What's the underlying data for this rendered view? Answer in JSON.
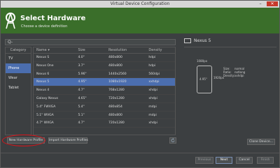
{
  "window": {
    "title": "Virtual Device Configuration"
  },
  "header": {
    "title": "Select Hardware",
    "subtitle": "Choose a device definition"
  },
  "search": {
    "placeholder": "Q-"
  },
  "categories": {
    "header": "Category",
    "items": [
      {
        "label": "TV",
        "selected": false
      },
      {
        "label": "Phone",
        "selected": true
      },
      {
        "label": "Wear",
        "selected": false
      },
      {
        "label": "Tablet",
        "selected": false
      }
    ]
  },
  "table": {
    "columns": [
      "Name ▾",
      "Size",
      "Resolution",
      "Density"
    ],
    "rows": [
      [
        "Nexus S",
        "4.0\"",
        "480x800",
        "hdpi"
      ],
      [
        "Nexus One",
        "3.7\"",
        "480x800",
        "hdpi"
      ],
      [
        "Nexus 6",
        "5.96\"",
        "1440x2560",
        "560dpi"
      ],
      [
        "Nexus 5",
        "4.95\"",
        "1080x1920",
        "xxhdpi"
      ],
      [
        "Nexus 4",
        "4.7\"",
        "768x1280",
        "xhdpi"
      ],
      [
        "Galaxy Nexus",
        "4.65\"",
        "720x1280",
        "xhdpi"
      ],
      [
        "5.4\" FWVGA",
        "5.4\"",
        "480x854",
        "mdpi"
      ],
      [
        "5.1\" WVGA",
        "5.1\"",
        "480x800",
        "mdpi"
      ],
      [
        "4.7\" WXGA",
        "4.7\"",
        "720x1280",
        "xhdpi"
      ]
    ],
    "selected_index": 3
  },
  "buttons": {
    "new_hardware": "New Hardware Profile",
    "import_hardware": "Import Hardware Profiles",
    "clone": "Clone Device..."
  },
  "preview": {
    "name": "Nexus 5",
    "width_label": "1080px",
    "height_label": "1920px",
    "diag_label": "4.95\"",
    "size_key": "Size:",
    "size_val": "normal",
    "ratio_key": "Ratio:",
    "ratio_val": "notlong",
    "density_key": "Density:",
    "density_val": "xxhdpi"
  },
  "footer": {
    "previous": "Previous",
    "next": "Next",
    "cancel": "Cancel",
    "finish": "Finish"
  },
  "colors": {
    "header_green": "#3a6e2a",
    "selection_blue": "#4b6eaf",
    "annotation_red": "#d8141a"
  }
}
